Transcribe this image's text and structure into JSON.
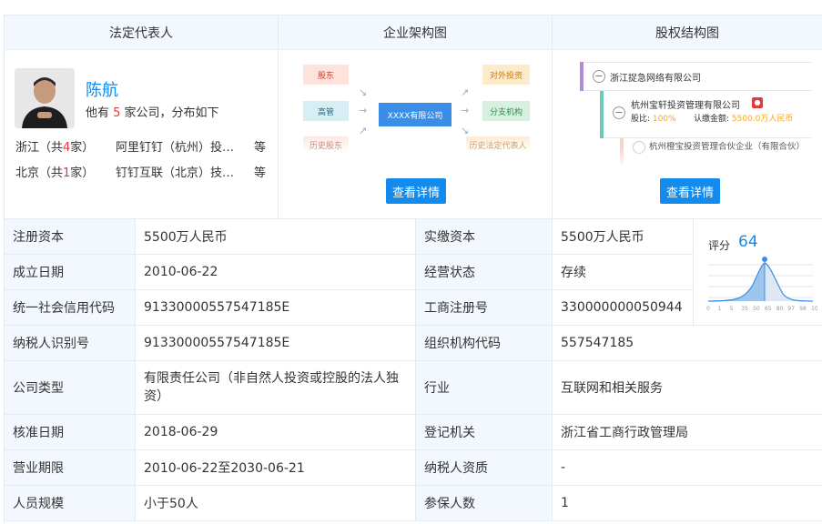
{
  "headers": {
    "legal_rep": "法定代表人",
    "org_chart": "企业架构图",
    "equity": "股权结构图"
  },
  "person": {
    "name": "陈航",
    "desc_prefix": "他有 ",
    "count": "5",
    "desc_suffix": " 家公司，分布如下",
    "rows": [
      {
        "region_a": "浙江（共",
        "num": "4",
        "region_b": "家）",
        "company": "阿里钉钉（杭州）投…",
        "tail": "等"
      },
      {
        "region_a": "北京（共",
        "num": "1",
        "region_b": "家）",
        "company": "钉钉互联（北京）技…",
        "tail": "等"
      }
    ]
  },
  "org": {
    "shareholder": "股东",
    "manager": "高管",
    "history_sh": "历史股东",
    "center": "XXXX有限公司",
    "invest": "对外投资",
    "branch": "分支机构",
    "history_rep": "历史法定代表人",
    "button": "查看详情"
  },
  "equity": {
    "root": "浙江捉急网络有限公司",
    "child": "杭州宝轩投资管理有限公司",
    "ratio_label": "股比:",
    "ratio": "100%",
    "amount_label": "认缴金额:",
    "amount": "5500.0万人民币",
    "grandchild": "杭州橙宝投资管理合伙企业（有限合伙）",
    "button": "查看详情"
  },
  "score": {
    "label": "评分",
    "value": "64",
    "ticks": [
      "0",
      "1",
      "5",
      "35",
      "50",
      "65",
      "80",
      "97",
      "98",
      "100"
    ]
  },
  "table": [
    {
      "l1": "注册资本",
      "v1": "5500万人民币",
      "l2": "实缴资本",
      "v2": "5500万人民币"
    },
    {
      "l1": "成立日期",
      "v1": "2010-06-22",
      "l2": "经营状态",
      "v2": "存续"
    },
    {
      "l1": "统一社会信用代码",
      "v1": "91330000557547185E",
      "l2": "工商注册号",
      "v2": "330000000050944"
    },
    {
      "l1": "纳税人识别号",
      "v1": "91330000557547185E",
      "l2": "组织机构代码",
      "v2": "557547185"
    },
    {
      "l1": "公司类型",
      "v1": "有限责任公司（非自然人投资或控股的法人独资）",
      "l2": "行业",
      "v2": "互联网和相关服务"
    },
    {
      "l1": "核准日期",
      "v1": "2018-06-29",
      "l2": "登记机关",
      "v2": "浙江省工商行政管理局"
    },
    {
      "l1": "营业期限",
      "v1": "2010-06-22至2030-06-21",
      "l2": "纳税人资质",
      "v2": "-"
    },
    {
      "l1": "人员规模",
      "v1": "小于50人",
      "l2": "参保人数",
      "v2": "1"
    }
  ]
}
